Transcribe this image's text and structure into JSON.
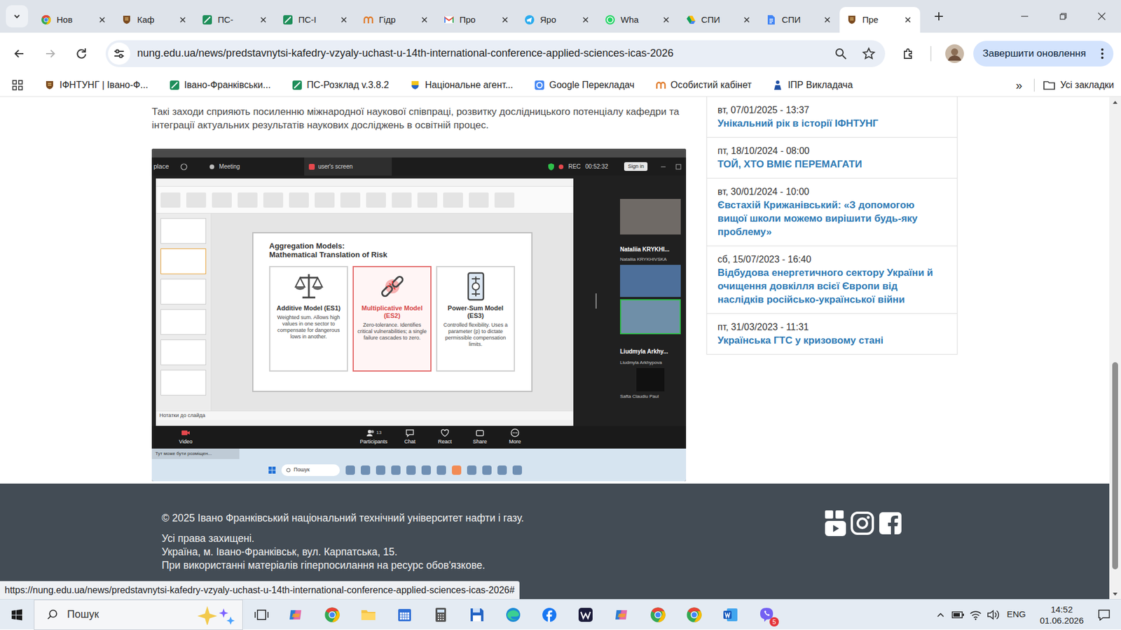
{
  "tabs": [
    {
      "label": "Нов",
      "kind": "chrome",
      "selected": false
    },
    {
      "label": "Каф",
      "kind": "university",
      "selected": false
    },
    {
      "label": "ПС-",
      "kind": "ps",
      "selected": false
    },
    {
      "label": "ПС-І",
      "kind": "ps",
      "selected": false
    },
    {
      "label": "Гідр",
      "kind": "hydro",
      "selected": false
    },
    {
      "label": "Про",
      "kind": "gmail",
      "selected": false
    },
    {
      "label": "Яро",
      "kind": "telegram",
      "selected": false
    },
    {
      "label": "Wha",
      "kind": "whatsapp",
      "selected": false
    },
    {
      "label": "СПИ",
      "kind": "drive",
      "selected": false
    },
    {
      "label": "СПИ",
      "kind": "docs",
      "selected": false
    },
    {
      "label": "Пре",
      "kind": "university",
      "selected": true
    }
  ],
  "address_bar": {
    "url": "nung.edu.ua/news/predstavnytsi-kafedry-vzyaly-uchast-u-14th-international-conference-applied-sciences-icas-2026",
    "update_button": "Завершити оновлення"
  },
  "bookmarks": {
    "items": [
      {
        "label": "ІФНТУНГ | Івано-Ф...",
        "kind": "university"
      },
      {
        "label": "Івано-Франківськи...",
        "kind": "ps"
      },
      {
        "label": "ПС-Розклад v.3.8.2",
        "kind": "ps"
      },
      {
        "label": "Національне агент...",
        "kind": "agency"
      },
      {
        "label": "Google Перекладач",
        "kind": "google"
      },
      {
        "label": "Особистий кабінет",
        "kind": "hydro"
      },
      {
        "label": "ІПР Викладача",
        "kind": "ipr"
      }
    ],
    "more": "»",
    "all_bookmarks": "Усі закладки"
  },
  "article": {
    "paragraph": "Такі заходи сприяють посиленню міжнародної наукової співпраці, розвитку дослідницького потенціалу кафедри та інтеграції актуальних результатів наукових досліджень в освітній процес.",
    "image": {
      "top_bar": {
        "place": "place",
        "meeting": "Meeting",
        "shared_screen": "user's screen",
        "rec": "REC",
        "timer": "00:52:32",
        "sign_in": "Sign in"
      },
      "slide": {
        "title": "Aggregation Models:",
        "subtitle": "Mathematical Translation of Risk",
        "cards": [
          {
            "title": "Additive Model (ES1)",
            "text": "Weighted sum. Allows high values in one sector to compensate for dangerous lows in another.",
            "kind": "scales",
            "highlighted": false
          },
          {
            "title": "Multiplicative Model (ES2)",
            "text": "Zero-tolerance. Identifies critical vulnerabilities; a single failure cascades to zero.",
            "kind": "chain",
            "highlighted": true
          },
          {
            "title": "Power-Sum Model (ES3)",
            "text": "Controlled flexibility. Uses a parameter (p) to dictate permissible compensation limits.",
            "kind": "gauge",
            "highlighted": false
          }
        ]
      },
      "notes": "Нотатки до слайда",
      "participants": {
        "first_name": "Nataliia KRYKHI...",
        "first_label": "Nataliia KRYKHIVSKA",
        "second_name": "Liudmyla Arkhy...",
        "second_label": "Liudmyla Arkhypova",
        "third_label": "Safta Claudiu Paul"
      },
      "toolbar": {
        "video": "Video",
        "participants": "Participants",
        "participants_count": "13",
        "chat": "Chat",
        "react": "React",
        "share": "Share",
        "more": "More"
      },
      "desktop": {
        "notice": "Тут може бути розміщен...",
        "search": "Пошук"
      }
    }
  },
  "sidebar": {
    "items": [
      {
        "date": "вт, 07/01/2025 - 13:37",
        "title": "Унікальний рік в історії ІФНТУНГ"
      },
      {
        "date": "пт, 18/10/2024 - 08:00",
        "title": "ТОЙ, ХТО ВМІЄ ПЕРЕМАГАТИ"
      },
      {
        "date": "вт, 30/01/2024 - 10:00",
        "title": "Євстахій Крижанівський: «З допомогою вищої школи можемо вирішити будь-яку проблему»"
      },
      {
        "date": "сб, 15/07/2023 - 16:40",
        "title": "Відбудова енергетичного сектору України й очищення довкілля всієї Європи від наслідків російсько-української війни"
      },
      {
        "date": "пт, 31/03/2023 - 11:31",
        "title": "Українська ГТС у кризовому стані"
      }
    ]
  },
  "footer": {
    "lines": [
      "© 2025 Івано Франківський національний технічний університет нафти і газу.",
      "Усі права захищені.",
      "Україна, м. Івано-Франківськ, вул. Карпатська, 15.",
      "При використанні матеріалів гіперпосилання на ресурс обов'язкове."
    ]
  },
  "status_url": "https://nung.edu.ua/news/predstavnytsi-kafedry-vzyaly-uchast-u-14th-international-conference-applied-sciences-icas-2026#",
  "scrollbar": {
    "level": 1
  },
  "taskbar": {
    "search": "Пошук",
    "apps": [
      {
        "kind": "copilot"
      },
      {
        "kind": "chrome"
      },
      {
        "kind": "explorer"
      },
      {
        "kind": "calendar"
      },
      {
        "kind": "calculator"
      },
      {
        "kind": "floppy"
      },
      {
        "kind": "edge"
      },
      {
        "kind": "facebook"
      },
      {
        "kind": "player"
      },
      {
        "kind": "copilot"
      },
      {
        "kind": "chrome"
      },
      {
        "kind": "chrome"
      },
      {
        "kind": "word"
      },
      {
        "kind": "viber",
        "badge": "5"
      }
    ],
    "language": "ENG",
    "time": "14:52",
    "date": "01.06.2026"
  }
}
